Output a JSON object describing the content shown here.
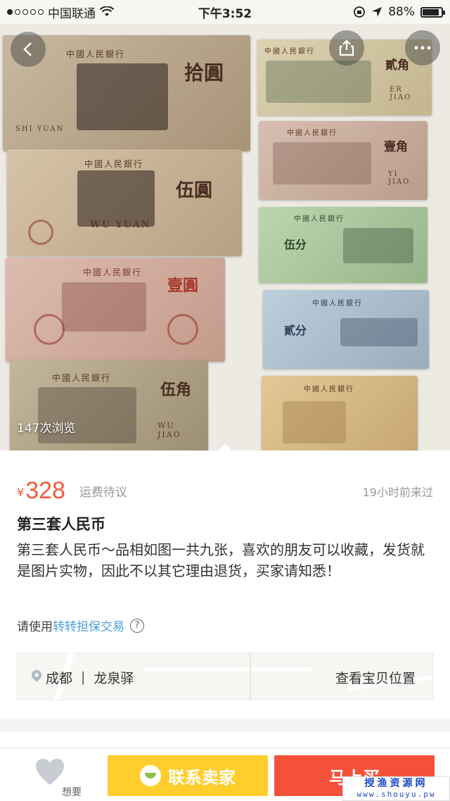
{
  "status_bar": {
    "carrier": "中国联通",
    "time": "下午3:52",
    "battery": "88%",
    "battery_level": 0.88
  },
  "photo": {
    "views": "147次浏览",
    "banknotes": [
      {
        "bank": "中國人民銀行",
        "denomination": "拾圓",
        "pinyin": "SHI YUAN",
        "color": "#b9a48c"
      },
      {
        "bank": "中國人民銀行",
        "denomination": "伍圓",
        "pinyin": "WU YUAN",
        "color": "#c9b49a"
      },
      {
        "bank": "中國人民銀行",
        "denomination": "壹圓",
        "pinyin": "",
        "color": "#d3aea0"
      },
      {
        "bank": "中國人民銀行",
        "denomination": "伍角",
        "pinyin": "WU JIAO",
        "color": "#b6a98f"
      },
      {
        "bank": "中國人民銀行",
        "denomination": "貳角",
        "pinyin": "ER JIAO",
        "color": "#cfc4a0"
      },
      {
        "bank": "中國人民銀行",
        "denomination": "壹角",
        "pinyin": "YI JIAO",
        "color": "#c8ae9e"
      },
      {
        "bank": "中國人民銀行",
        "denomination": "伍分",
        "pinyin": "",
        "color": "#a8c39c"
      },
      {
        "bank": "中國人民銀行",
        "denomination": "貳分",
        "pinyin": "",
        "color": "#a9bccb"
      },
      {
        "bank": "中國人民銀行",
        "denomination": "",
        "pinyin": "",
        "color": "#d8bb86"
      }
    ]
  },
  "listing": {
    "currency": "¥",
    "price": "328",
    "shipping": "运费待议",
    "last_seen": "19小时前来过",
    "title": "第三套人民币",
    "description": "第三套人民币～品相如图一共九张，喜欢的朋友可以收藏，发货就是图片实物，因此不以其它理由退货，买家请知悉！",
    "guarantee_prefix": "请使用",
    "guarantee_link": "转转担保交易",
    "help": "?",
    "city": "成都",
    "separator": "|",
    "district": "龙泉驿",
    "view_location": "查看宝贝位置"
  },
  "actions": {
    "want_label": "想要",
    "contact_label": "联系卖家",
    "buy_label": "马上买"
  },
  "watermark": {
    "line1": "授渔资源网",
    "line2": "www.shouyu.pw"
  },
  "colors": {
    "accent": "#f55a3c",
    "link": "#4a9fe0",
    "contact": "#ffcd2c",
    "buy": "#f5503a"
  }
}
